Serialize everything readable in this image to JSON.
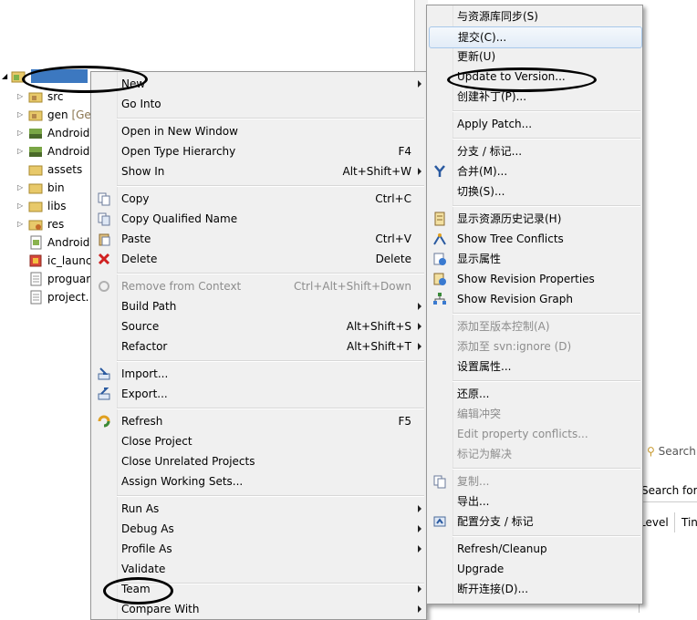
{
  "tree": {
    "items": [
      {
        "label": "src"
      },
      {
        "label": "gen",
        "suffix": "[Ge"
      },
      {
        "label": "Android"
      },
      {
        "label": "Android"
      },
      {
        "label": "assets"
      },
      {
        "label": "bin"
      },
      {
        "label": "libs"
      },
      {
        "label": "res"
      },
      {
        "label": "Android"
      },
      {
        "label": "ic_launc"
      },
      {
        "label": "proguar"
      },
      {
        "label": "project."
      }
    ]
  },
  "context_menu": {
    "items": [
      {
        "label": "New",
        "submenu": true
      },
      {
        "label": "Go Into"
      },
      {
        "label": "Open in New Window"
      },
      {
        "label": "Open Type Hierarchy",
        "shortcut": "F4"
      },
      {
        "label": "Show In",
        "shortcut": "Alt+Shift+W",
        "submenu": true
      },
      {
        "label": "Copy",
        "shortcut": "Ctrl+C",
        "icon": "copy-icon"
      },
      {
        "label": "Copy Qualified Name",
        "icon": "copy-qualified-icon"
      },
      {
        "label": "Paste",
        "shortcut": "Ctrl+V",
        "icon": "paste-icon"
      },
      {
        "label": "Delete",
        "shortcut": "Delete",
        "icon": "delete-icon"
      },
      {
        "label": "Remove from Context",
        "shortcut": "Ctrl+Alt+Shift+Down",
        "disabled": true,
        "icon": "remove-context-icon"
      },
      {
        "label": "Build Path",
        "submenu": true
      },
      {
        "label": "Source",
        "shortcut": "Alt+Shift+S",
        "submenu": true
      },
      {
        "label": "Refactor",
        "shortcut": "Alt+Shift+T",
        "submenu": true
      },
      {
        "label": "Import...",
        "icon": "import-icon"
      },
      {
        "label": "Export...",
        "icon": "export-icon"
      },
      {
        "label": "Refresh",
        "shortcut": "F5",
        "icon": "refresh-icon"
      },
      {
        "label": "Close Project"
      },
      {
        "label": "Close Unrelated Projects"
      },
      {
        "label": "Assign Working Sets..."
      },
      {
        "label": "Run As",
        "submenu": true
      },
      {
        "label": "Debug As",
        "submenu": true
      },
      {
        "label": "Profile As",
        "submenu": true
      },
      {
        "label": "Validate"
      },
      {
        "label": "Team",
        "submenu": true
      },
      {
        "label": "Compare With",
        "submenu": true
      }
    ]
  },
  "team_menu": {
    "items": [
      {
        "label": "与资源库同步(S)"
      },
      {
        "label": "提交(C)...",
        "highlighted": true
      },
      {
        "label": "更新(U)"
      },
      {
        "label": "Update to Version..."
      },
      {
        "label": "创建补丁(P)..."
      },
      {
        "label": "Apply Patch..."
      },
      {
        "label": "分支 / 标记..."
      },
      {
        "label": "合并(M)...",
        "icon": "merge-icon"
      },
      {
        "label": "切换(S)..."
      },
      {
        "label": "显示资源历史记录(H)",
        "icon": "history-icon"
      },
      {
        "label": "Show Tree Conflicts",
        "icon": "tree-conflicts-icon"
      },
      {
        "label": "显示属性",
        "icon": "properties-icon"
      },
      {
        "label": "Show Revision Properties",
        "icon": "revision-properties-icon"
      },
      {
        "label": "Show Revision Graph",
        "icon": "revision-graph-icon"
      },
      {
        "label": "添加至版本控制(A)",
        "disabled": true
      },
      {
        "label": "添加至 svn:ignore (D)",
        "disabled": true
      },
      {
        "label": "设置属性..."
      },
      {
        "label": "还原..."
      },
      {
        "label": "编辑冲突",
        "disabled": true
      },
      {
        "label": "Edit property conflicts...",
        "disabled": true
      },
      {
        "label": "标记为解决",
        "disabled": true
      },
      {
        "label": "复制...",
        "disabled": true,
        "icon": "copy-icon"
      },
      {
        "label": "导出..."
      },
      {
        "label": "配置分支 / 标记",
        "icon": "configure-branches-icon"
      },
      {
        "label": "Refresh/Cleanup"
      },
      {
        "label": "Upgrade"
      },
      {
        "label": "断开连接(D)..."
      }
    ]
  },
  "side_panel": {
    "search_tab": "Search",
    "search_field": "Search for",
    "col_level": "Level",
    "col_time": "Tin"
  },
  "colors": {
    "menu_bg": "#f0f0f0",
    "highlight_border": "#a8c8ea",
    "disabled_text": "#8d8d8d",
    "annotation_ellipse": "#000000"
  }
}
